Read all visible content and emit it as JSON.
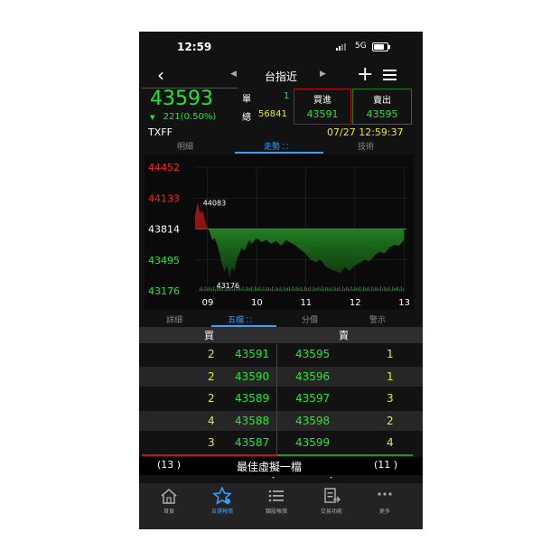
{
  "status": {
    "time": "12:59",
    "network": "5G"
  },
  "nav": {
    "title": "台指近",
    "left_arrow": "◀",
    "right_arrow": "▶"
  },
  "quote": {
    "last": "43593",
    "change": "221(0.50%)",
    "direction": "down",
    "single_label": "單",
    "single_value": "1",
    "total_label": "總",
    "total_value": "56841",
    "bid_label": "買進",
    "bid_value": "43591",
    "ask_label": "賣出",
    "ask_value": "43595",
    "code": "TXFF",
    "datetime": "07/27 12:59:37"
  },
  "tabs_top": [
    {
      "label": "明細",
      "active": false
    },
    {
      "label": "走勢",
      "active": true
    },
    {
      "label": "技術",
      "active": false
    }
  ],
  "chart_data": {
    "type": "area",
    "x_ticks": [
      "09",
      "10",
      "11",
      "12",
      "13"
    ],
    "y_ticks": [
      "44452",
      "44133",
      "43814",
      "43495",
      "43176"
    ],
    "ylim": [
      43176,
      44452
    ],
    "reference": 43814,
    "high_label": "44083",
    "low_label": "43176",
    "x_hours": [
      8.75,
      8.8,
      8.85,
      8.9,
      8.95,
      9.0,
      9.05,
      9.1,
      9.15,
      9.2,
      9.25,
      9.3,
      9.35,
      9.4,
      9.45,
      9.5,
      9.55,
      9.6,
      9.65,
      9.7,
      9.75,
      9.8,
      9.85,
      9.9,
      10.0,
      10.1,
      10.2,
      10.3,
      10.4,
      10.5,
      10.6,
      10.7,
      10.8,
      10.9,
      11.0,
      11.1,
      11.2,
      11.3,
      11.4,
      11.5,
      11.6,
      11.7,
      11.8,
      11.9,
      12.0,
      12.1,
      12.2,
      12.3,
      12.4,
      12.5,
      12.6,
      12.7,
      12.8,
      12.9,
      13.0
    ],
    "y_values": [
      43950,
      44083,
      43970,
      44010,
      43900,
      43830,
      43780,
      43700,
      43720,
      43650,
      43560,
      43450,
      43370,
      43440,
      43300,
      43420,
      43380,
      43500,
      43560,
      43620,
      43590,
      43640,
      43700,
      43660,
      43720,
      43680,
      43700,
      43660,
      43690,
      43640,
      43700,
      43670,
      43640,
      43600,
      43560,
      43500,
      43470,
      43500,
      43430,
      43400,
      43380,
      43360,
      43420,
      43380,
      43440,
      43460,
      43500,
      43480,
      43540,
      43580,
      43560,
      43620,
      43650,
      43640,
      43700
    ]
  },
  "tabs_mid": [
    {
      "label": "詳細",
      "active": false
    },
    {
      "label": "五檔",
      "active": true
    },
    {
      "label": "分價",
      "active": false
    },
    {
      "label": "警示",
      "active": false
    }
  ],
  "orderbook": {
    "buy_header": "買",
    "sell_header": "賣",
    "rows": [
      {
        "bid_qty": "2",
        "bid": "43591",
        "ask": "43595",
        "ask_qty": "1"
      },
      {
        "bid_qty": "2",
        "bid": "43590",
        "ask": "43596",
        "ask_qty": "1"
      },
      {
        "bid_qty": "2",
        "bid": "43589",
        "ask": "43597",
        "ask_qty": "3"
      },
      {
        "bid_qty": "4",
        "bid": "43588",
        "ask": "43598",
        "ask_qty": "2"
      },
      {
        "bid_qty": "3",
        "bid": "43587",
        "ask": "43599",
        "ask_qty": "4"
      }
    ],
    "summary_left": "(13 )",
    "summary_center": "最佳虛擬一檔",
    "summary_right": "(11 )",
    "dash_left": "-",
    "dash_right": "-"
  },
  "bottom_nav": [
    {
      "label": "首頁",
      "icon": "home-icon",
      "active": false
    },
    {
      "label": "自選報價",
      "icon": "star-icon",
      "active": true
    },
    {
      "label": "類股報價",
      "icon": "list-icon",
      "active": false
    },
    {
      "label": "交易功能",
      "icon": "trade-icon",
      "active": false
    },
    {
      "label": "更多",
      "icon": "more-icon",
      "active": false
    }
  ],
  "colors": {
    "up": "#22e632",
    "down": "#ff2020",
    "accent": "#3a9eff",
    "qty": "#e8e832"
  }
}
